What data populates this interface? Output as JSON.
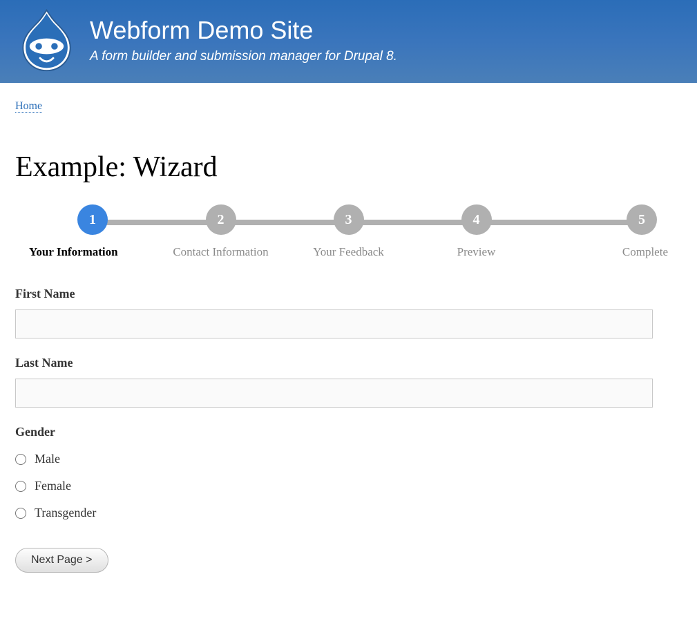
{
  "header": {
    "title": "Webform Demo Site",
    "slogan": "A form builder and submission manager for Drupal 8."
  },
  "breadcrumb": {
    "home": "Home"
  },
  "page": {
    "title": "Example: Wizard"
  },
  "wizard": {
    "steps": [
      {
        "num": "1",
        "label": "Your Information",
        "active": true
      },
      {
        "num": "2",
        "label": "Contact Information",
        "active": false
      },
      {
        "num": "3",
        "label": "Your Feedback",
        "active": false
      },
      {
        "num": "4",
        "label": "Preview",
        "active": false
      },
      {
        "num": "5",
        "label": "Complete",
        "active": false
      }
    ]
  },
  "form": {
    "firstName": {
      "label": "First Name",
      "value": ""
    },
    "lastName": {
      "label": "Last Name",
      "value": ""
    },
    "gender": {
      "label": "Gender",
      "options": [
        "Male",
        "Female",
        "Transgender"
      ]
    },
    "submit": "Next Page >"
  }
}
